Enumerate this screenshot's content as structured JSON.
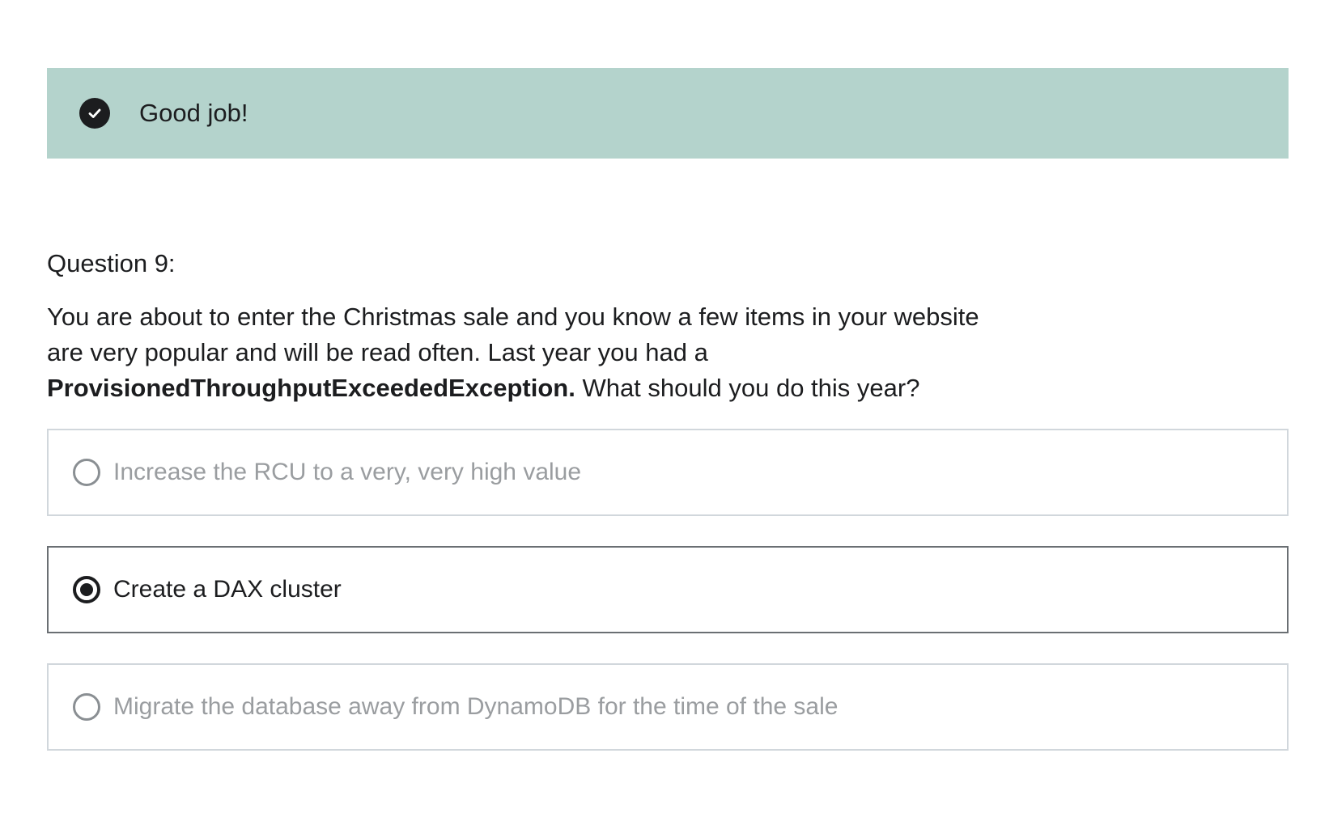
{
  "feedback": {
    "icon": "check-circle-icon",
    "message": "Good job!",
    "background_color": "#b4d3cc"
  },
  "question": {
    "label": "Question 9:",
    "text_part1": "You are about to enter the Christmas sale and you know a few items in your website are very popular and will be read often. Last year you had a ",
    "text_bold": "ProvisionedThroughputExceededException.",
    "text_part2": " What should you do this year?"
  },
  "options": [
    {
      "label": "Increase the RCU to a very, very high value",
      "selected": false
    },
    {
      "label": "Create a DAX cluster",
      "selected": true
    },
    {
      "label": "Migrate the database away from DynamoDB for the time of the sale",
      "selected": false
    }
  ]
}
